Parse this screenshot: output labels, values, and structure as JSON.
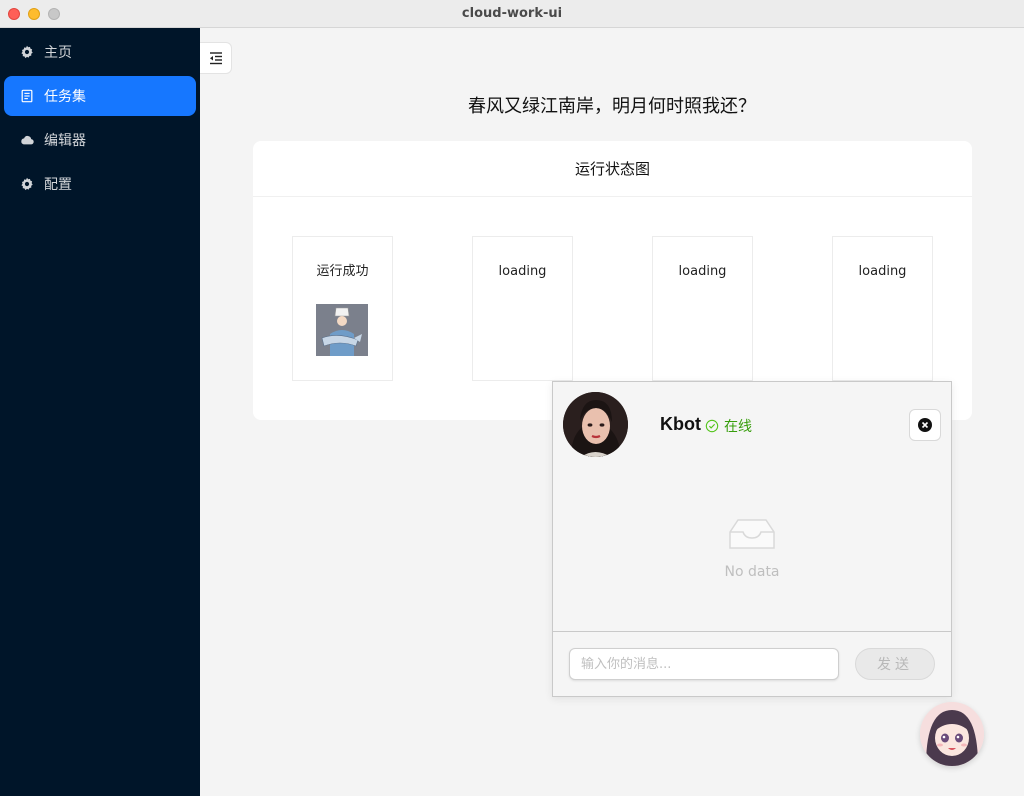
{
  "window": {
    "title": "cloud-work-ui"
  },
  "sidebar": {
    "items": [
      {
        "label": "主页",
        "icon": "gear-icon",
        "active": false
      },
      {
        "label": "任务集",
        "icon": "task-icon",
        "active": true
      },
      {
        "label": "编辑器",
        "icon": "cloud-icon",
        "active": false
      },
      {
        "label": "配置",
        "icon": "gear-icon",
        "active": false
      }
    ]
  },
  "main": {
    "toggle_icon": "menu-fold-icon",
    "headline": "春风又绿江南岸，明月何时照我还？",
    "card": {
      "title": "运行状态图",
      "statuses": [
        {
          "text": "运行成功",
          "has_image": true
        },
        {
          "text": "loading",
          "has_image": false
        },
        {
          "text": "loading",
          "has_image": false
        },
        {
          "text": "loading",
          "has_image": false
        }
      ]
    }
  },
  "chat": {
    "name": "Kbot",
    "status": "在线",
    "status_color": "#389e0d",
    "empty_text": "No data",
    "input_placeholder": "输入你的消息...",
    "send_label": "发送"
  },
  "colors": {
    "sidebar_bg": "#001529",
    "accent": "#1677ff"
  }
}
